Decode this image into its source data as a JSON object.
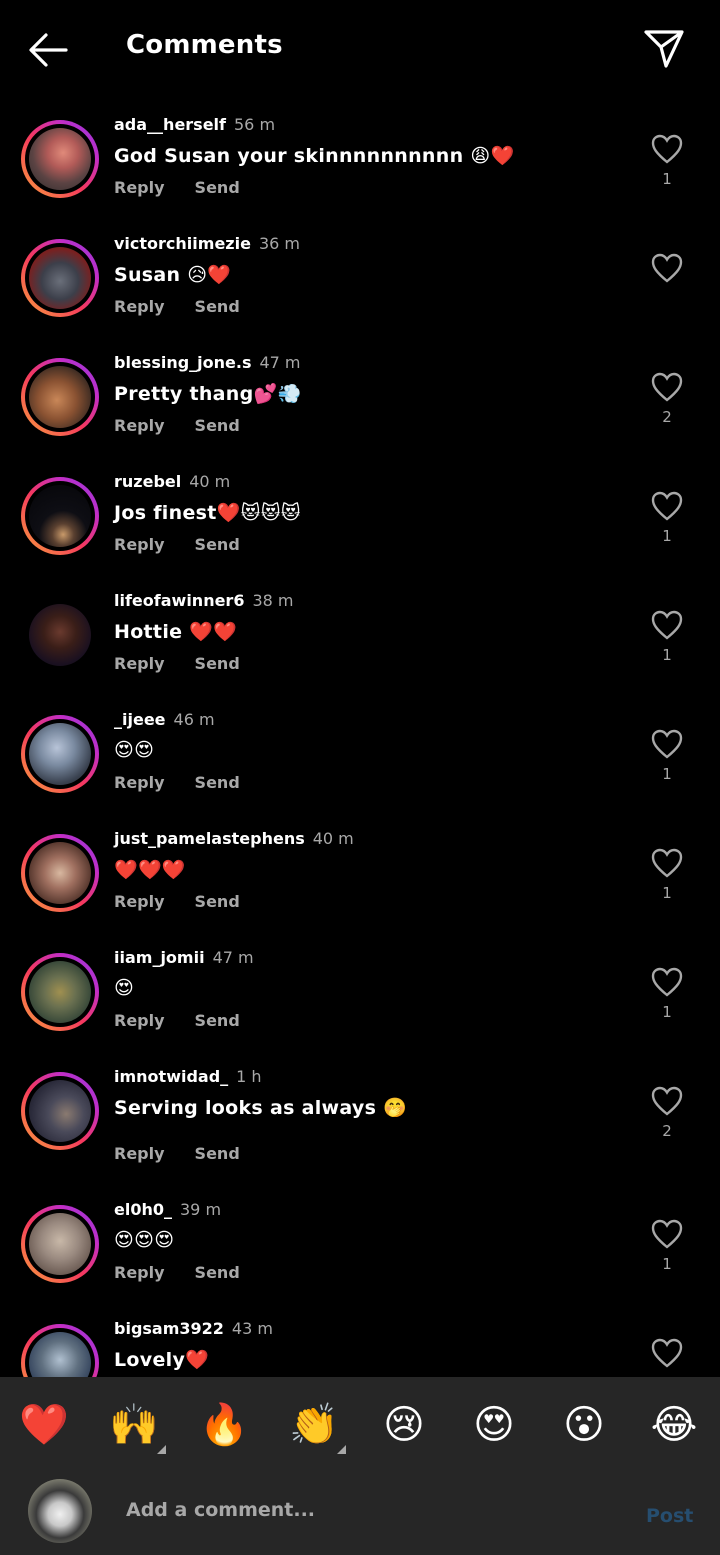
{
  "header": {
    "title": "Comments",
    "back_icon": "back-arrow-icon",
    "share_icon": "paper-plane-icon"
  },
  "actions": {
    "reply": "Reply",
    "send": "Send"
  },
  "comments": [
    {
      "user": "ada__herself",
      "time": "56 m",
      "text": "God Susan your skinnnnnnnnnn 😩❤️",
      "likes": "1"
    },
    {
      "user": "victorchiimezie",
      "time": "36 m",
      "text": "Susan 😥❤️",
      "likes": ""
    },
    {
      "user": "blessing_jone.s",
      "time": "47 m",
      "text": "Pretty thang💕💨",
      "likes": "2"
    },
    {
      "user": "ruzebel",
      "time": "40 m",
      "text": "Jos finest❤️😻😻😻",
      "likes": "1"
    },
    {
      "user": "lifeofawinner6",
      "time": "38 m",
      "text": "Hottie ❤️❤️",
      "likes": "1"
    },
    {
      "user": "_ijeee",
      "time": "46 m",
      "text": "😍😍",
      "likes": "1"
    },
    {
      "user": "just_pamelastephens",
      "time": "40 m",
      "text": "❤️❤️❤️",
      "likes": "1"
    },
    {
      "user": "iiam_jomii",
      "time": "47 m",
      "text": "😍",
      "likes": "1"
    },
    {
      "user": "imnotwidad_",
      "time": "1 h",
      "text": "Serving looks as always 🤭",
      "likes": "2"
    },
    {
      "user": "el0h0_",
      "time": "39 m",
      "text": "😍😍😍",
      "likes": "1"
    },
    {
      "user": "bigsam3922",
      "time": "43 m",
      "text": "Lovely❤️",
      "likes": ""
    }
  ],
  "emoji_bar": [
    "❤️",
    "🙌",
    "🔥",
    "👏",
    "😢",
    "😍",
    "😮",
    "😂"
  ],
  "composer": {
    "placeholder": "Add a comment...",
    "post_label": "Post"
  },
  "colors": {
    "background": "#000000",
    "panel": "#262626",
    "muted": "#a8a8a8",
    "post": "#264e70"
  }
}
